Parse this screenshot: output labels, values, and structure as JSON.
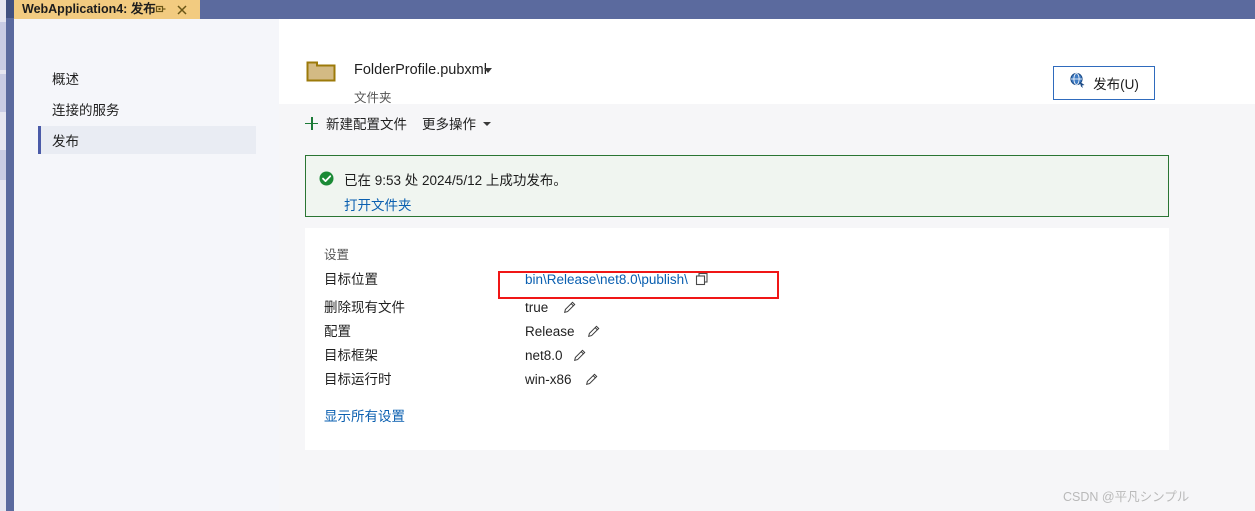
{
  "window": {
    "tab_title": "WebApplication4: 发布",
    "pin_icon": "pin-icon",
    "close_icon": "close-icon"
  },
  "sidebar": {
    "items": [
      {
        "label": "概述",
        "selected": false
      },
      {
        "label": "连接的服务",
        "selected": false
      },
      {
        "label": "发布",
        "selected": true
      }
    ]
  },
  "profile": {
    "icon": "folder-icon",
    "name": "FolderProfile.pubxml",
    "subtitle": "文件夹",
    "dropdown_icon": "chevron-down-icon"
  },
  "publish_button": {
    "label": "发布(U)",
    "icon": "publish-globe-icon",
    "border_color": "#2f6bbd"
  },
  "toolbar": {
    "new_profile_label": "新建配置文件",
    "new_profile_icon": "plus-icon",
    "more_actions_label": "更多操作",
    "more_actions_icon": "chevron-down-icon"
  },
  "status": {
    "icon": "success-check-icon",
    "message": "已在 9:53 处 2024/5/12 上成功发布。",
    "link_label": "打开文件夹",
    "border_color": "#2a7533",
    "background_color": "#f0f5f0"
  },
  "settings": {
    "title": "设置",
    "rows": [
      {
        "key": "目标位置",
        "value": "bin\\Release\\net8.0\\publish\\",
        "is_link": true,
        "action_icon": "copy-icon"
      },
      {
        "key": "删除现有文件",
        "value": "true",
        "is_link": false,
        "action_icon": "edit-pencil-icon"
      },
      {
        "key": "配置",
        "value": "Release",
        "is_link": false,
        "action_icon": "edit-pencil-icon"
      },
      {
        "key": "目标框架",
        "value": "net8.0",
        "is_link": false,
        "action_icon": "edit-pencil-icon"
      },
      {
        "key": "目标运行时",
        "value": "win-x86",
        "is_link": false,
        "action_icon": "edit-pencil-icon"
      }
    ],
    "show_all_label": "显示所有设置"
  },
  "annotation": {
    "color": "#f01616",
    "target": "目标位置"
  },
  "watermark": {
    "text": "CSDN @平凡シンプル"
  }
}
